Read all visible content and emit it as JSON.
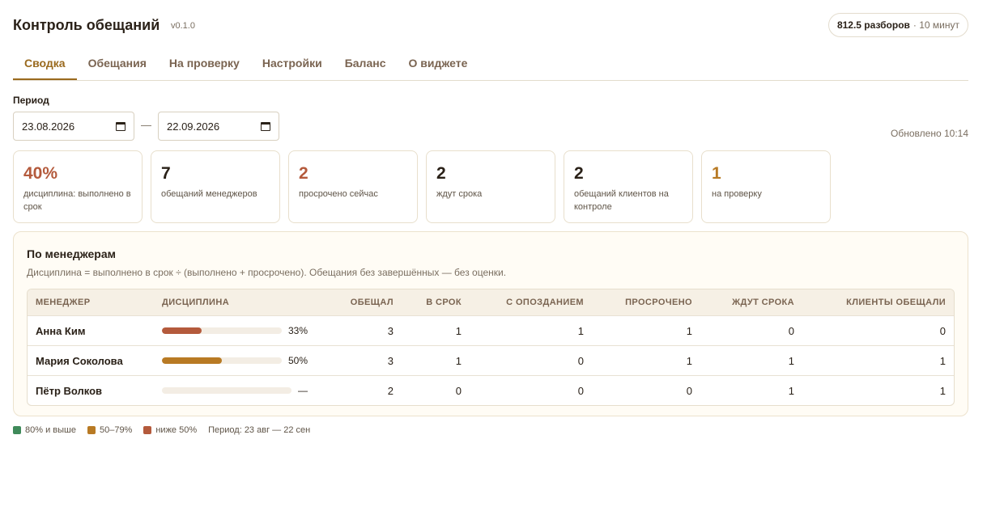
{
  "app": {
    "title": "Контроль обещаний",
    "version": "v0.1.0"
  },
  "balance": {
    "main": "812.5 разборов",
    "sub": "· 10 минут"
  },
  "tabs": [
    {
      "label": "Сводка",
      "active": true
    },
    {
      "label": "Обещания",
      "active": false
    },
    {
      "label": "На проверку",
      "active": false
    },
    {
      "label": "Настройки",
      "active": false
    },
    {
      "label": "Баланс",
      "active": false
    },
    {
      "label": "О виджете",
      "active": false
    }
  ],
  "period": {
    "label": "Период",
    "from": "23.08.2026",
    "to": "22.09.2026",
    "separator": "—"
  },
  "updated": "Обновлено 10:14",
  "kpis": [
    {
      "value": "40%",
      "label": "дисциплина: выполнено в срок",
      "color": "#b45a3c"
    },
    {
      "value": "7",
      "label": "обещаний менеджеров",
      "color": "#2a2118"
    },
    {
      "value": "2",
      "label": "просрочено сейчас",
      "color": "#b45a3c"
    },
    {
      "value": "2",
      "label": "ждут срока",
      "color": "#2a2118"
    },
    {
      "value": "2",
      "label": "обещаний клиентов на контроле",
      "color": "#2a2118"
    },
    {
      "value": "1",
      "label": "на проверку",
      "color": "#b87a24"
    }
  ],
  "managers": {
    "title": "По менеджерам",
    "subtitle": "Дисциплина = выполнено в срок ÷ (выполнено + просрочено). Обещания без завершённых — без оценки.",
    "columns": {
      "name": "МЕНЕДЖЕР",
      "discipline": "ДИСЦИПЛИНА",
      "promised": "ОБЕЩАЛ",
      "on_time": "В СРОК",
      "late": "С ОПОЗДАНИЕМ",
      "overdue": "ПРОСРОЧЕНО",
      "waiting": "ЖДУТ СРОКА",
      "clients": "КЛИЕНТЫ ОБЕЩАЛИ"
    },
    "rows": [
      {
        "name": "Анна Ким",
        "discipline": 0.33,
        "discipline_text": "33%",
        "bar_color": "#b45a3c",
        "promised": "3",
        "on_time": "1",
        "late": "1",
        "overdue": "1",
        "waiting": "0",
        "clients": "0"
      },
      {
        "name": "Мария Соколова",
        "discipline": 0.5,
        "discipline_text": "50%",
        "bar_color": "#b87a24",
        "promised": "3",
        "on_time": "1",
        "late": "0",
        "overdue": "1",
        "waiting": "1",
        "clients": "1"
      },
      {
        "name": "Пётр Волков",
        "discipline": 0,
        "discipline_text": "—",
        "bar_color": "#b45a3c",
        "promised": "2",
        "on_time": "0",
        "late": "0",
        "overdue": "0",
        "waiting": "1",
        "clients": "1"
      }
    ]
  },
  "legend": {
    "items": [
      {
        "label": "80% и выше",
        "color": "#3f8a5a"
      },
      {
        "label": "50–79%",
        "color": "#b87a24"
      },
      {
        "label": "ниже 50%",
        "color": "#b45a3c"
      }
    ],
    "period": "Период: 23 авг — 22 сен"
  }
}
